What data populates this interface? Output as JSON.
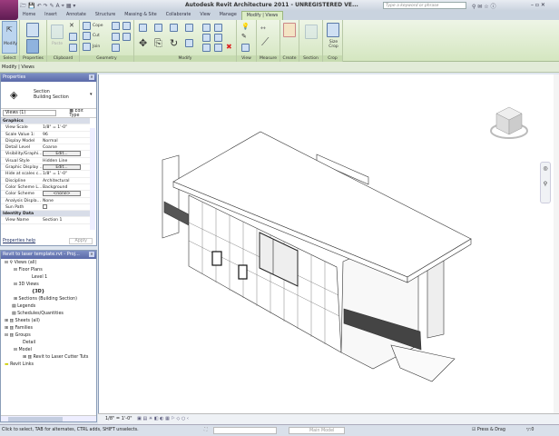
{
  "titlebar": {
    "title": "Autodesk Revit Architecture 2011 - UNREGISTERED VE...",
    "search_placeholder": "Type a keyword or phrase"
  },
  "tabs": [
    "Home",
    "Insert",
    "Annotate",
    "Structure",
    "Massing & Site",
    "Collaborate",
    "View",
    "Manage",
    "Modify | Views"
  ],
  "ribbon": {
    "select": {
      "label": "Select",
      "modify": "Modify"
    },
    "properties": {
      "label": "Properties"
    },
    "clipboard": {
      "label": "Clipboard",
      "paste": "Paste"
    },
    "geometry": {
      "label": "Geometry",
      "cope": "Cope",
      "cut": "Cut",
      "join": "Join"
    },
    "modify": {
      "label": "Modify"
    },
    "view": {
      "label": "View"
    },
    "measure": {
      "label": "Measure"
    },
    "create": {
      "label": "Create"
    },
    "section": {
      "label": "Section"
    },
    "crop": {
      "label": "Crop",
      "size_crop": "Size Crop"
    }
  },
  "options_bar": "Modify | Views",
  "properties": {
    "header": "Properties",
    "type_family": "Section",
    "type_name": "Building Section",
    "selector": "Views (1)",
    "edit_type": "Edit Type",
    "groups": [
      {
        "name": "Graphics",
        "rows": [
          {
            "k": "View Scale",
            "v": "1/8\" = 1'-0\""
          },
          {
            "k": "Scale Value 1:",
            "v": "96"
          },
          {
            "k": "Display Model",
            "v": "Normal"
          },
          {
            "k": "Detail Level",
            "v": "Coarse"
          },
          {
            "k": "Visibility/Graphi...",
            "v": "Edit...",
            "btn": true
          },
          {
            "k": "Visual Style",
            "v": "Hidden Line"
          },
          {
            "k": "Graphic Display ...",
            "v": "Edit...",
            "btn": true
          },
          {
            "k": "Hide at scales c...",
            "v": "1/8\" = 1'-0\""
          },
          {
            "k": "Discipline",
            "v": "Architectural"
          },
          {
            "k": "Color Scheme L...",
            "v": "Background"
          },
          {
            "k": "Color Scheme",
            "v": "<none>",
            "btn": true
          },
          {
            "k": "Analysis Displa...",
            "v": "None"
          },
          {
            "k": "Sun Path",
            "v": ""
          }
        ]
      },
      {
        "name": "Identity Data",
        "rows": [
          {
            "k": "View Name",
            "v": "Section 1"
          }
        ]
      }
    ],
    "help_link": "Properties help",
    "apply": "Apply"
  },
  "browser": {
    "header": "Revit to laser template.rvt - Proj...",
    "items": [
      "Views (all)",
      "Floor Plans",
      "Level 1",
      "3D Views",
      "{3D}",
      "Sections (Building Section)",
      "Legends",
      "Schedules/Quantities",
      "Sheets (all)",
      "Families",
      "Groups",
      "Detail",
      "Model",
      "Revit to Laser Cutter Tuts",
      "Revit Links"
    ]
  },
  "viewbar": {
    "scale": "1/8\" = 1'-0\""
  },
  "status": {
    "hint": "Click to select, TAB for alternates, CTRL adds, SHIFT unselects.",
    "model": "Main Model",
    "press_drag": "Press & Drag",
    "filter_count": ":0"
  }
}
